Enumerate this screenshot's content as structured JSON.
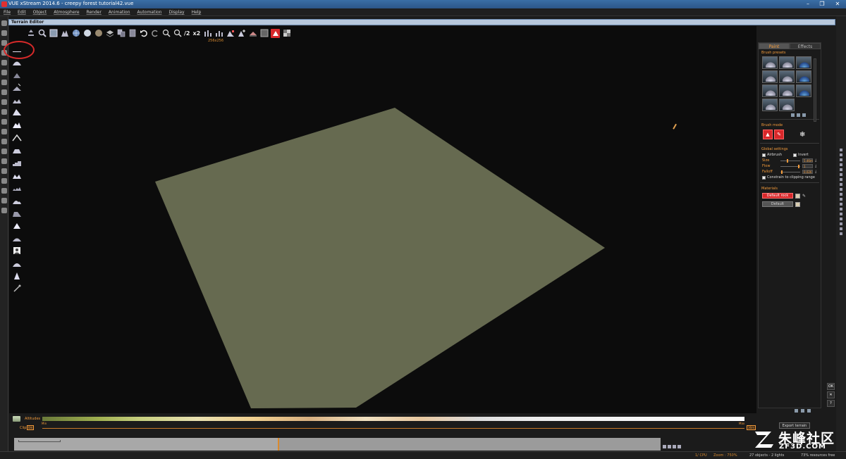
{
  "window": {
    "title": "VUE xStream 2014.6 - creepy forest tutorial42.vue",
    "controls": [
      "–",
      "❐",
      "✕"
    ]
  },
  "menu": [
    "File",
    "Edit",
    "Object",
    "Atmosphere",
    "Render",
    "Animation",
    "Automation",
    "Display",
    "Help"
  ],
  "editor": {
    "title": "Terrain Editor",
    "resolution": "256x256",
    "zoom_text_1": "/2",
    "zoom_text_2": "x2"
  },
  "terrain_color": "#666a50",
  "panel": {
    "tabs": [
      "Paint",
      "Effects"
    ],
    "active_tab": "Paint",
    "brush_presets_label": "Brush presets",
    "brush_mode_label": "Brush mode",
    "global_settings_label": "Global settings",
    "airbrush_label": "Airbrush",
    "invert_label": "Invert",
    "settings": [
      {
        "label": "Size",
        "value": "5.46m",
        "level": 0.35
      },
      {
        "label": "Flow",
        "value": "1",
        "level": 0.95
      },
      {
        "label": "Falloff",
        "value": "0.026",
        "level": 0.05
      }
    ],
    "constrain_label": "Constrain to clipping range",
    "materials_label": "Materials",
    "materials": [
      {
        "name": "Default rock",
        "selected": true
      },
      {
        "name": "Default",
        "selected": false
      }
    ]
  },
  "side_buttons": [
    "OK",
    "✕",
    "?"
  ],
  "bottom": {
    "altitudes_label": "Altitudes",
    "alt_min": "Min",
    "alt_max": "Max",
    "clip_label": "Clip",
    "clip_min": "0m",
    "clip_max": "36m",
    "export_label": "Export terrain"
  },
  "status": {
    "cpu": "1/ CPU",
    "zoom": "Zoom : 750%",
    "objects": "27 objects - 2 lights",
    "resources": "73% resources free"
  },
  "watermark": {
    "text_cn": "朱峰社区",
    "text_en": "ZF3D.COM"
  }
}
